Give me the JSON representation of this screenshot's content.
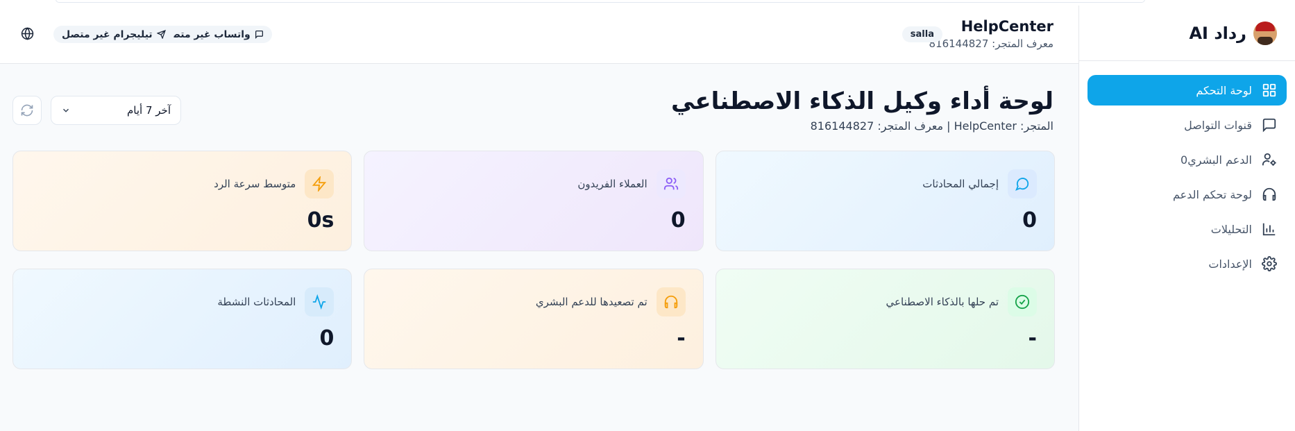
{
  "colors": {
    "accent": "#0ea5e9",
    "blue_icon": "#0ea5e9",
    "purple_icon": "#8b5cf6",
    "amber_icon": "#f59e0b",
    "green_icon": "#16a34a"
  },
  "sidebar": {
    "brand_name": "رداد AI",
    "items": [
      {
        "label": "لوحة التحكم",
        "icon": "dashboard-grid-icon",
        "active": true
      },
      {
        "label": "قنوات التواصل",
        "icon": "chat-icon",
        "active": false
      },
      {
        "label": "الدعم البشري0",
        "icon": "user-gear-icon",
        "active": false
      },
      {
        "label": "لوحة تحكم الدعم",
        "icon": "headphones-icon",
        "active": false
      },
      {
        "label": "التحليلات",
        "icon": "bar-chart-icon",
        "active": false
      },
      {
        "label": "الإعدادات",
        "icon": "gear-icon",
        "active": false
      }
    ]
  },
  "header": {
    "store_name": "HelpCenter",
    "store_id": "معرف المتجر: 816144827",
    "platform": "salla",
    "whatsapp_status": "واتساب غير متصل",
    "telegram_status": "تيليجرام غير متصل"
  },
  "main": {
    "title": "لوحة أداء وكيل الذكاء الاصطناعي",
    "subtitle": "المتجر: HelpCenter | معرف المتجر: 816144827",
    "range_selected": "آخر 7 أيام",
    "cards": [
      {
        "label": "إجمالي المحادثات",
        "value": "0",
        "icon": "chat-bubble-icon"
      },
      {
        "label": "العملاء الفريدون",
        "value": "0",
        "icon": "users-icon"
      },
      {
        "label": "متوسط سرعة الرد",
        "value": "0s",
        "icon": "lightning-icon"
      },
      {
        "label": "تم حلها بالذكاء الاصطناعي",
        "value": "-",
        "icon": "check-circle-icon"
      },
      {
        "label": "تم تصعيدها للدعم البشري",
        "value": "-",
        "icon": "headphones-icon"
      },
      {
        "label": "المحادثات النشطة",
        "value": "0",
        "icon": "activity-icon"
      }
    ]
  }
}
